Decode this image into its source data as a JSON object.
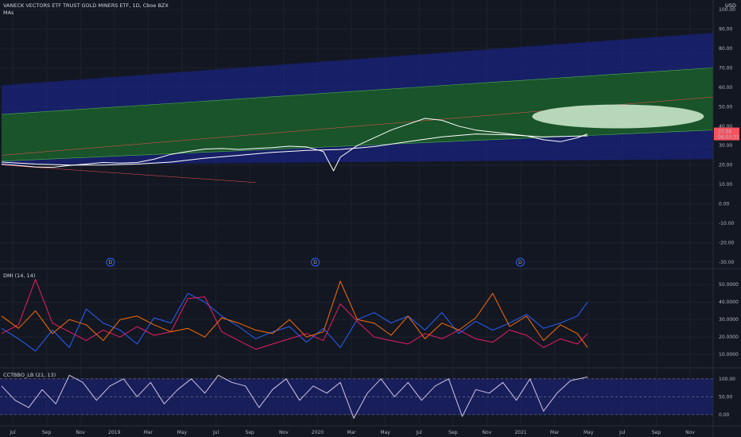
{
  "header": {
    "symbol_title": "VANECK VECTORS ETF TRUST GOLD MINERS ETF, 1D, Cboe BZX",
    "indicator_label": "MAs",
    "currency": "USD"
  },
  "price_tag": {
    "value": "37.98",
    "countdown": "06:00:31"
  },
  "dividend_markers": [
    {
      "label": "D",
      "month_index": 5.3
    },
    {
      "label": "D",
      "month_index": 17.4
    },
    {
      "label": "D",
      "month_index": 29.5
    }
  ],
  "chart_data": [
    {
      "type": "line",
      "pane": "price",
      "title": "",
      "ylim": [
        -30,
        100
      ],
      "y_ticks": [
        "100.00",
        "90.00",
        "80.00",
        "70.00",
        "60.00",
        "50.00",
        "40.00",
        "30.00",
        "20.00",
        "10.00",
        "0.00",
        "-10.00",
        "-20.00",
        "-30.00"
      ],
      "y_tick_values": [
        100,
        90,
        80,
        70,
        60,
        50,
        40,
        30,
        20,
        10,
        0,
        -10,
        -20,
        -30
      ],
      "series": [
        {
          "key": "price",
          "color": "#ffffff",
          "x_month": [
            0,
            1,
            2,
            3,
            4,
            5,
            6,
            7,
            8,
            9,
            10,
            11,
            12,
            13,
            14,
            15,
            16,
            17,
            18,
            19,
            19.6,
            20,
            21,
            22,
            23,
            24,
            25,
            26,
            27,
            28,
            29,
            30,
            31,
            32,
            33,
            34,
            34.6
          ],
          "values": [
            20.5,
            19.8,
            19,
            18.8,
            19.8,
            20.5,
            21.3,
            21,
            21.3,
            23,
            25.5,
            27,
            28.2,
            28.5,
            28,
            28.5,
            29,
            29.7,
            29.3,
            27,
            17,
            24,
            30,
            34,
            38,
            41,
            44,
            43,
            40,
            38,
            37,
            36,
            35,
            33,
            32,
            34,
            36
          ]
        },
        {
          "key": "ma_slow",
          "color": "#ffffff",
          "x_month": [
            0,
            2,
            4,
            6,
            8,
            10,
            12,
            14,
            16,
            18,
            20,
            22,
            24,
            26,
            28,
            30,
            32,
            34.6
          ],
          "values": [
            21.5,
            20.5,
            20,
            20,
            20.5,
            21.5,
            23.5,
            25,
            26.5,
            27.5,
            28,
            29.5,
            32,
            34.5,
            36,
            35.5,
            34.5,
            35
          ]
        }
      ],
      "channels": [
        {
          "name": "outer",
          "color": "#1a237e",
          "x_month": [
            0,
            34.6,
            42
          ],
          "upper": [
            61,
            77,
            86
          ],
          "lower": [
            20,
            22,
            23
          ],
          "upper_end": 88,
          "lower_end": 23
        },
        {
          "name": "inner",
          "color": "#1b5e20",
          "x_month": [
            0,
            42
          ],
          "upper": [
            46,
            70
          ],
          "lower": [
            22,
            38
          ]
        }
      ],
      "ellipse": {
        "x_month": 36.4,
        "y": 45,
        "color": "#c8e6c9"
      },
      "x_ticks": [
        "Jul",
        "Sep",
        "Nov",
        "2019",
        "Mar",
        "May",
        "Jul",
        "Sep",
        "Nov",
        "2020",
        "Mar",
        "May",
        "Jul",
        "Sep",
        "Nov",
        "2021",
        "Mar",
        "May",
        "Jul",
        "Sep",
        "Nov"
      ],
      "x_tick_month": [
        0,
        2,
        4,
        6,
        8,
        10,
        12,
        14,
        16,
        18,
        20,
        22,
        24,
        26,
        28,
        30,
        32,
        34,
        36,
        38,
        40
      ]
    },
    {
      "type": "line",
      "pane": "dmi",
      "title": "DMI (14, 14)",
      "ylim": [
        6,
        56
      ],
      "y_ticks": [
        "50.0000",
        "40.0000",
        "30.0000",
        "20.0000",
        "10.0000"
      ],
      "y_tick_values": [
        50,
        40,
        30,
        20,
        10
      ],
      "series": [
        {
          "key": "plus_di",
          "color": "#2962ff",
          "x_month": [
            0,
            1,
            2,
            3,
            4,
            5,
            6,
            7,
            8,
            9,
            10,
            11,
            12,
            13,
            14,
            15,
            16,
            17,
            18,
            19,
            20,
            21,
            22,
            23,
            24,
            25,
            26,
            27,
            28,
            29,
            30,
            31,
            32,
            33,
            34,
            34.6
          ],
          "values": [
            25,
            19,
            12,
            24,
            14,
            36,
            28,
            24,
            16,
            31,
            28,
            45,
            40,
            32,
            26,
            19,
            23,
            26,
            17,
            25,
            14,
            30,
            34,
            28,
            32,
            24,
            34,
            22,
            29,
            24,
            28,
            33,
            25,
            28,
            32,
            40
          ]
        },
        {
          "key": "minus_di",
          "color": "#e91e63",
          "x_month": [
            0,
            1,
            2,
            3,
            4,
            5,
            6,
            7,
            8,
            9,
            10,
            11,
            12,
            13,
            14,
            15,
            16,
            17,
            18,
            19,
            20,
            21,
            22,
            23,
            24,
            25,
            26,
            27,
            28,
            29,
            30,
            31,
            32,
            33,
            34,
            34.6
          ],
          "values": [
            22,
            27,
            53,
            28,
            23,
            18,
            24,
            20,
            26,
            21,
            23,
            42,
            43,
            23,
            18,
            13,
            16,
            19,
            22,
            18,
            39,
            29,
            20,
            18,
            16,
            22,
            19,
            24,
            19,
            17,
            24,
            21,
            14,
            19,
            16,
            22
          ]
        },
        {
          "key": "adx",
          "color": "#ff6d00",
          "x_month": [
            0,
            1,
            2,
            3,
            4,
            5,
            6,
            7,
            8,
            9,
            10,
            11,
            12,
            13,
            14,
            15,
            16,
            17,
            18,
            19,
            20,
            21,
            22,
            23,
            24,
            25,
            26,
            27,
            28,
            29,
            30,
            31,
            32,
            33,
            34,
            34.6
          ],
          "values": [
            32,
            25,
            35,
            22,
            30,
            27,
            18,
            30,
            32,
            27,
            23,
            25,
            20,
            31,
            28,
            24,
            22,
            30,
            20,
            23,
            52,
            30,
            28,
            21,
            32,
            19,
            28,
            24,
            31,
            45,
            26,
            32,
            18,
            27,
            22,
            14
          ]
        }
      ]
    },
    {
      "type": "line",
      "pane": "cctbbo",
      "title": "CCTBBO_LB (21, 13)",
      "ylim": [
        -18,
        115
      ],
      "y_ticks": [
        "100.00",
        "50.00",
        "0.00"
      ],
      "y_tick_values": [
        100,
        50,
        0
      ],
      "band": {
        "upper": 100,
        "lower": 0,
        "color": "#1a237e"
      },
      "series": [
        {
          "key": "oscillator",
          "color": "#d1c4e9",
          "x_month": [
            0,
            0.8,
            1.6,
            2.4,
            3.2,
            4,
            4.8,
            5.6,
            6.4,
            7.2,
            8,
            8.8,
            9.6,
            10.4,
            11.2,
            12,
            12.8,
            13.6,
            14.4,
            15.2,
            16,
            16.8,
            17.6,
            18.4,
            19.2,
            20,
            20.8,
            21.6,
            22.4,
            23.2,
            24,
            24.8,
            25.6,
            26.4,
            27.2,
            28,
            28.8,
            29.6,
            30.4,
            31.2,
            32,
            32.8,
            33.6,
            34.6
          ],
          "values": [
            80,
            40,
            20,
            70,
            30,
            110,
            90,
            40,
            80,
            100,
            50,
            90,
            30,
            70,
            100,
            60,
            110,
            90,
            80,
            20,
            70,
            100,
            40,
            80,
            60,
            90,
            -10,
            60,
            100,
            50,
            90,
            40,
            80,
            100,
            -5,
            70,
            60,
            90,
            40,
            100,
            10,
            60,
            95,
            105
          ]
        }
      ]
    }
  ]
}
